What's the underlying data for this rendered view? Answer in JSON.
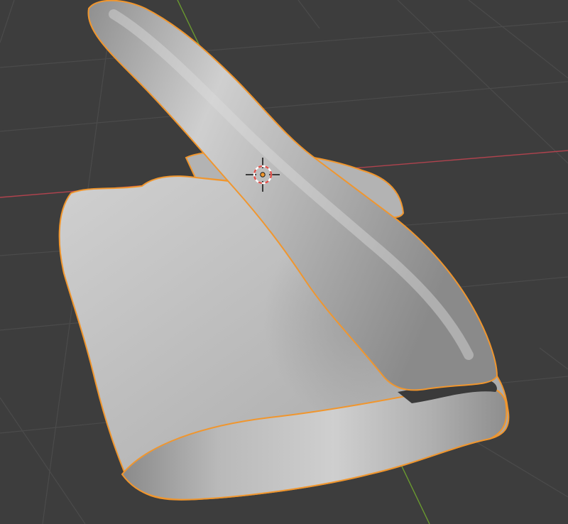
{
  "app": "3D viewport",
  "colors": {
    "background": "#3d3d3d",
    "grid": "#4a4a4a",
    "x_axis": "#b0434e",
    "y_axis": "#6a9a2f",
    "selection_outline": "#f0962e",
    "mesh_light": "#c9c9c9",
    "mesh_mid": "#a9a9a9",
    "mesh_dark": "#7c7c7c",
    "cursor_red": "#e0514b",
    "cursor_white": "#ffffff",
    "cursor_black": "#1a1a1a",
    "origin": "#f0962e"
  },
  "scene": {
    "object": {
      "shape": "hand-pointing",
      "selected": true,
      "shading": "solid-gray"
    },
    "icons": {
      "cursor": "3d-cursor-icon",
      "origin": "object-origin-icon"
    }
  }
}
